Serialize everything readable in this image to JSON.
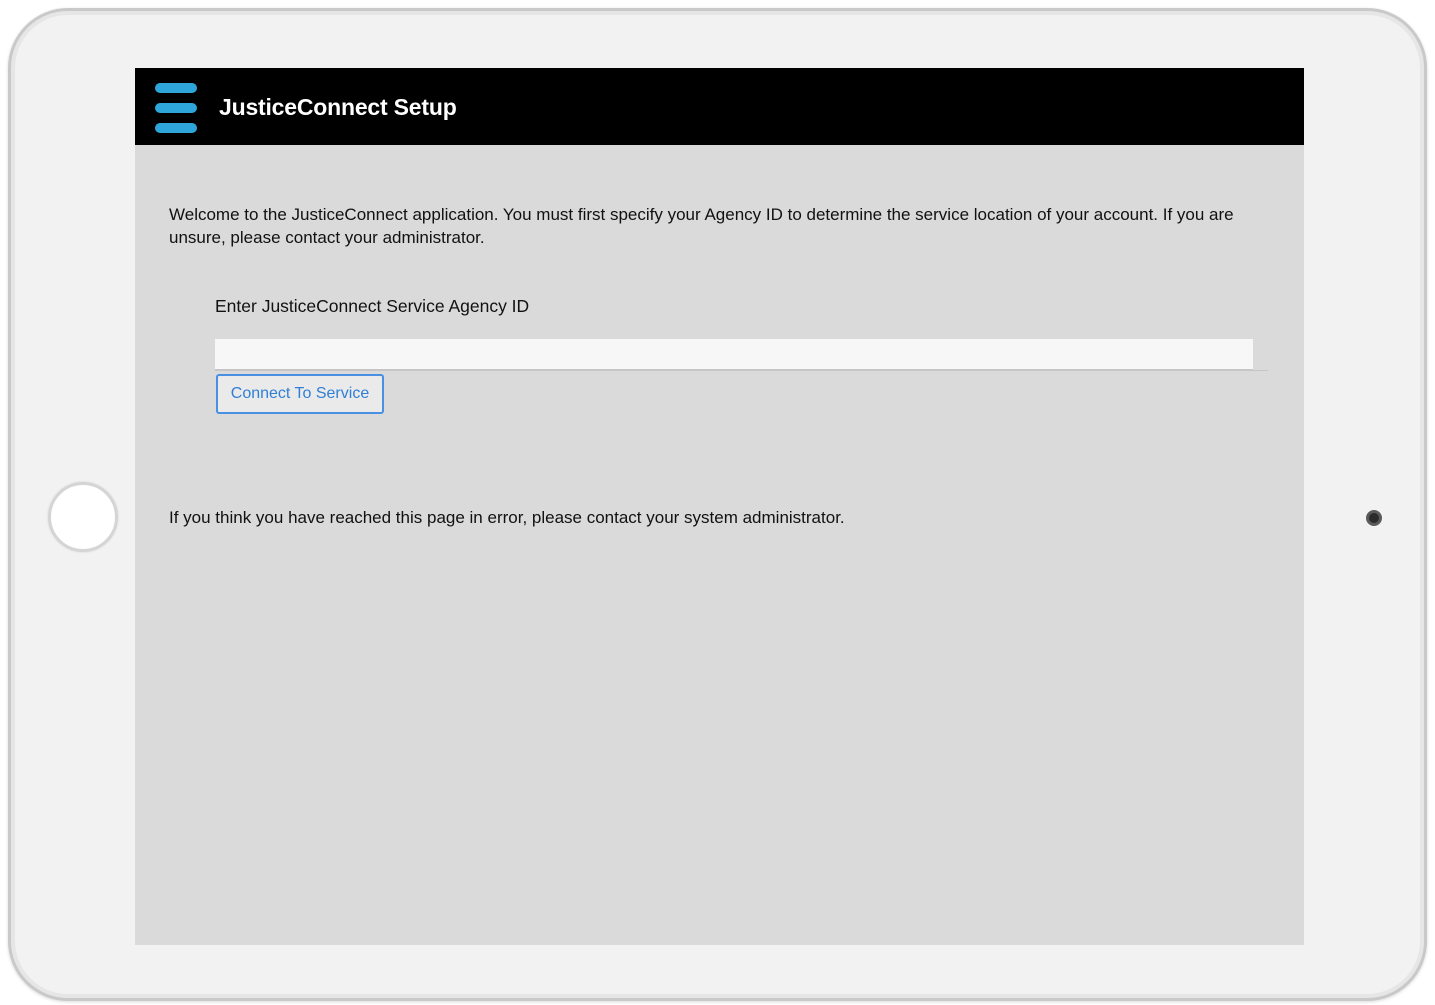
{
  "header": {
    "menu_icon": "hamburger-menu-icon",
    "title": "JusticeConnect Setup",
    "background_color": "#000000",
    "accent_color": "#2ea6d9"
  },
  "main": {
    "welcome_message": "Welcome to the JusticeConnect application. You must first specify your Agency ID to determine the service location of your account. If you are unsure, please contact your administrator.",
    "agency_id_label": "Enter JusticeConnect Service Agency ID",
    "agency_id_value": "",
    "agency_id_placeholder": "",
    "connect_button_label": "Connect To Service",
    "error_message": "If you think you have reached this page in error, please contact your system administrator."
  },
  "device": {
    "home_button_icon": "home-button",
    "camera_icon": "front-camera"
  }
}
